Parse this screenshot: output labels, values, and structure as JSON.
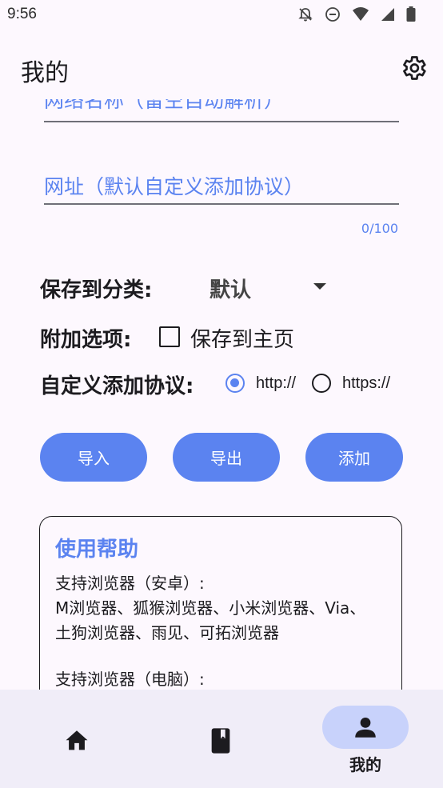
{
  "status_bar": {
    "time": "9:56"
  },
  "app_bar": {
    "title": "我的"
  },
  "form": {
    "field1_placeholder": "网络名称（留空自动解析）",
    "field2_placeholder": "网址（默认自定义添加协议）",
    "counter": "0/100",
    "category_label": "保存到分类:",
    "category_value": "默认",
    "options_label": "附加选项:",
    "save_home_label": "保存到主页",
    "protocol_label": "自定义添加协议:",
    "http_label": "http://",
    "https_label": "https://",
    "protocol_selected": "http://"
  },
  "buttons": {
    "import": "导入",
    "export": "导出",
    "add": "添加"
  },
  "help": {
    "title": "使用帮助",
    "line1": "支持浏览器（安卓）:",
    "line2": "M浏览器、狐猴浏览器、小米浏览器、Via、",
    "line3": "土狗浏览器、雨见、可拓浏览器",
    "line4": "支持浏览器（电脑）:"
  },
  "bottom_nav": {
    "items": [
      {
        "icon": "home-icon",
        "label": ""
      },
      {
        "icon": "book-icon",
        "label": ""
      },
      {
        "icon": "person-icon",
        "label": "我的"
      }
    ],
    "active_index": 2
  },
  "colors": {
    "accent": "#5b83f0",
    "background": "#fdf8fe",
    "nav_background": "#f0edf8",
    "nav_pill": "#c8d2fb"
  }
}
